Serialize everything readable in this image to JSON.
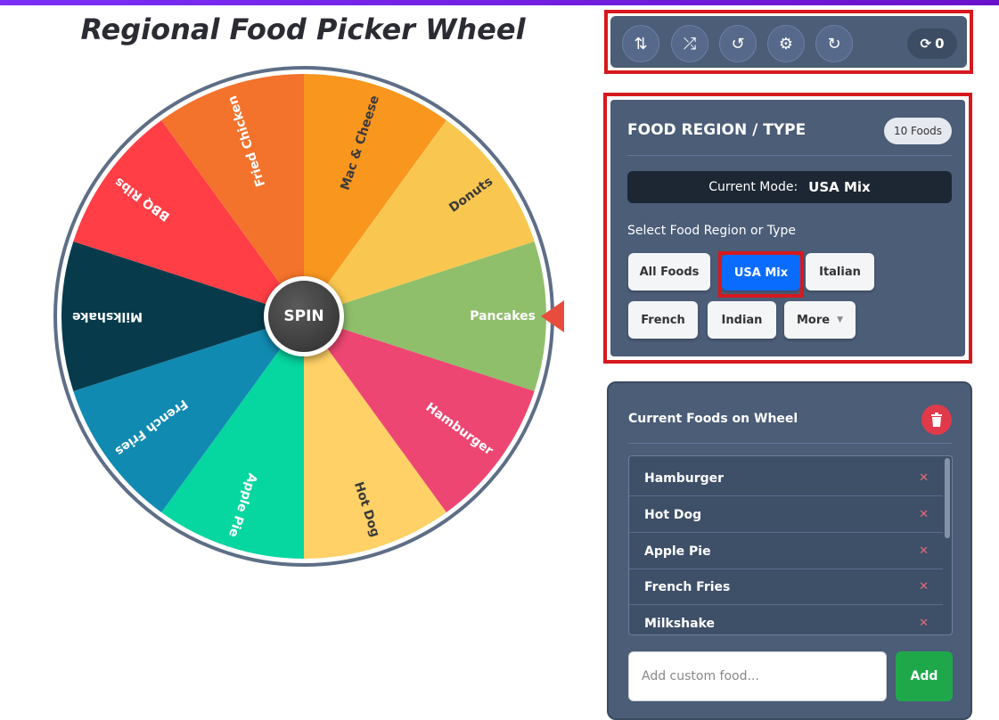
{
  "app": {
    "title": "Regional Food Picker Wheel"
  },
  "wheel": {
    "spin_label": "SPIN",
    "segments": [
      {
        "label": "Pancakes",
        "color": "#8fbf6b"
      },
      {
        "label": "Hamburger",
        "color": "#ee4672"
      },
      {
        "label": "Hot Dog",
        "color": "#ffd166"
      },
      {
        "label": "Apple Pie",
        "color": "#06d6a0"
      },
      {
        "label": "French Fries",
        "color": "#118ab2"
      },
      {
        "label": "Milkshake",
        "color": "#073b4c"
      },
      {
        "label": "BBQ Ribs",
        "color": "#ff3e45"
      },
      {
        "label": "Fried Chicken",
        "color": "#f3722c"
      },
      {
        "label": "Mac & Cheese",
        "color": "#f8961e"
      },
      {
        "label": "Donuts",
        "color": "#f9c74f"
      }
    ],
    "pointer_color": "#e74c3c"
  },
  "toolbar": {
    "buttons": [
      {
        "name": "sort-icon",
        "glyph": "⇅"
      },
      {
        "name": "shuffle-icon",
        "glyph": "⤮"
      },
      {
        "name": "history-icon",
        "glyph": "↺"
      },
      {
        "name": "gear-icon",
        "glyph": "⚙"
      },
      {
        "name": "redo-icon",
        "glyph": "↻"
      }
    ],
    "spin_count": "0",
    "spin_count_icon": "⟳"
  },
  "region": {
    "title": "FOOD REGION / TYPE",
    "count_badge": "10 Foods",
    "current_mode_label": "Current Mode:",
    "current_mode_value": "USA Mix",
    "select_label": "Select Food Region or Type",
    "chips": [
      "All Foods",
      "USA Mix",
      "Italian",
      "French",
      "Indian",
      "More"
    ],
    "more_caret": "▼"
  },
  "foods": {
    "title": "Current Foods on Wheel",
    "items": [
      "Hamburger",
      "Hot Dog",
      "Apple Pie",
      "French Fries",
      "Milkshake"
    ],
    "remove_glyph": "✕",
    "input_placeholder": "Add custom food...",
    "add_label": "Add"
  }
}
